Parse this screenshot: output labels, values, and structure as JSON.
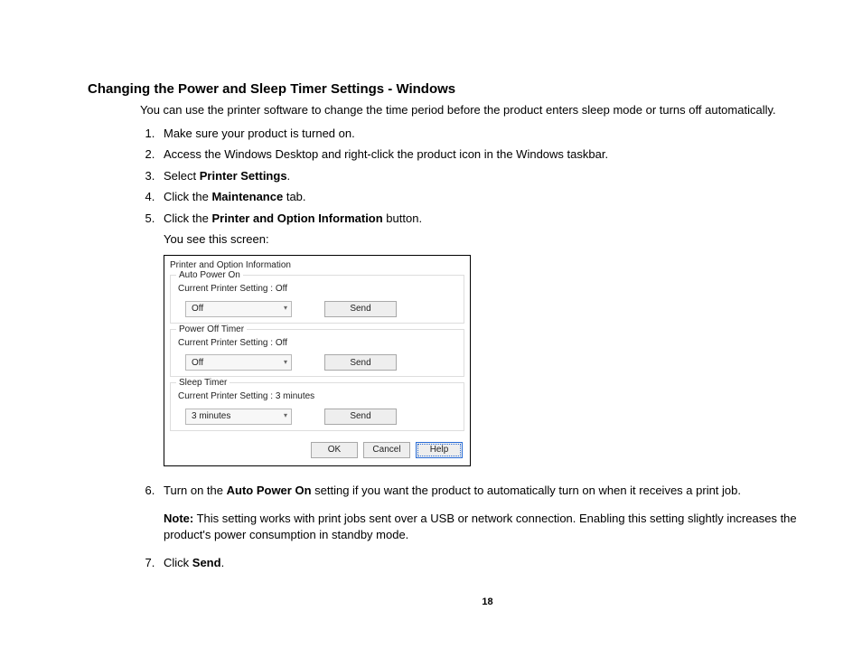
{
  "title": "Changing the Power and Sleep Timer Settings - Windows",
  "intro": "You can use the printer software to change the time period before the product enters sleep mode or turns off automatically.",
  "steps": {
    "s1": "Make sure your product is turned on.",
    "s2": "Access the Windows Desktop and right-click the product icon in the Windows taskbar.",
    "s3_a": "Select ",
    "s3_b": "Printer Settings",
    "s3_c": ".",
    "s4_a": "Click the ",
    "s4_b": "Maintenance",
    "s4_c": " tab.",
    "s5_a": "Click the ",
    "s5_b": "Printer and Option Information",
    "s5_c": " button.",
    "s5_sub": "You see this screen:",
    "s6_a": "Turn on the ",
    "s6_b": "Auto Power On",
    "s6_c": " setting if you want the product to automatically turn on when it receives a print job.",
    "s6_note_a": "Note:",
    "s6_note_b": " This setting works with print jobs sent over a USB or network connection. Enabling this setting slightly increases the product's power consumption in standby mode.",
    "s7_a": "Click ",
    "s7_b": "Send",
    "s7_c": "."
  },
  "dialog": {
    "title": "Printer and Option Information",
    "auto_power": {
      "group": "Auto Power On",
      "current": "Current Printer Setting : Off",
      "value": "Off",
      "send": "Send"
    },
    "power_off": {
      "group": "Power Off Timer",
      "current": "Current Printer Setting : Off",
      "value": "Off",
      "send": "Send"
    },
    "sleep": {
      "group": "Sleep Timer",
      "current": "Current Printer Setting : 3 minutes",
      "value": "3 minutes",
      "send": "Send"
    },
    "ok": "OK",
    "cancel": "Cancel",
    "help": "Help"
  },
  "page_number": "18"
}
